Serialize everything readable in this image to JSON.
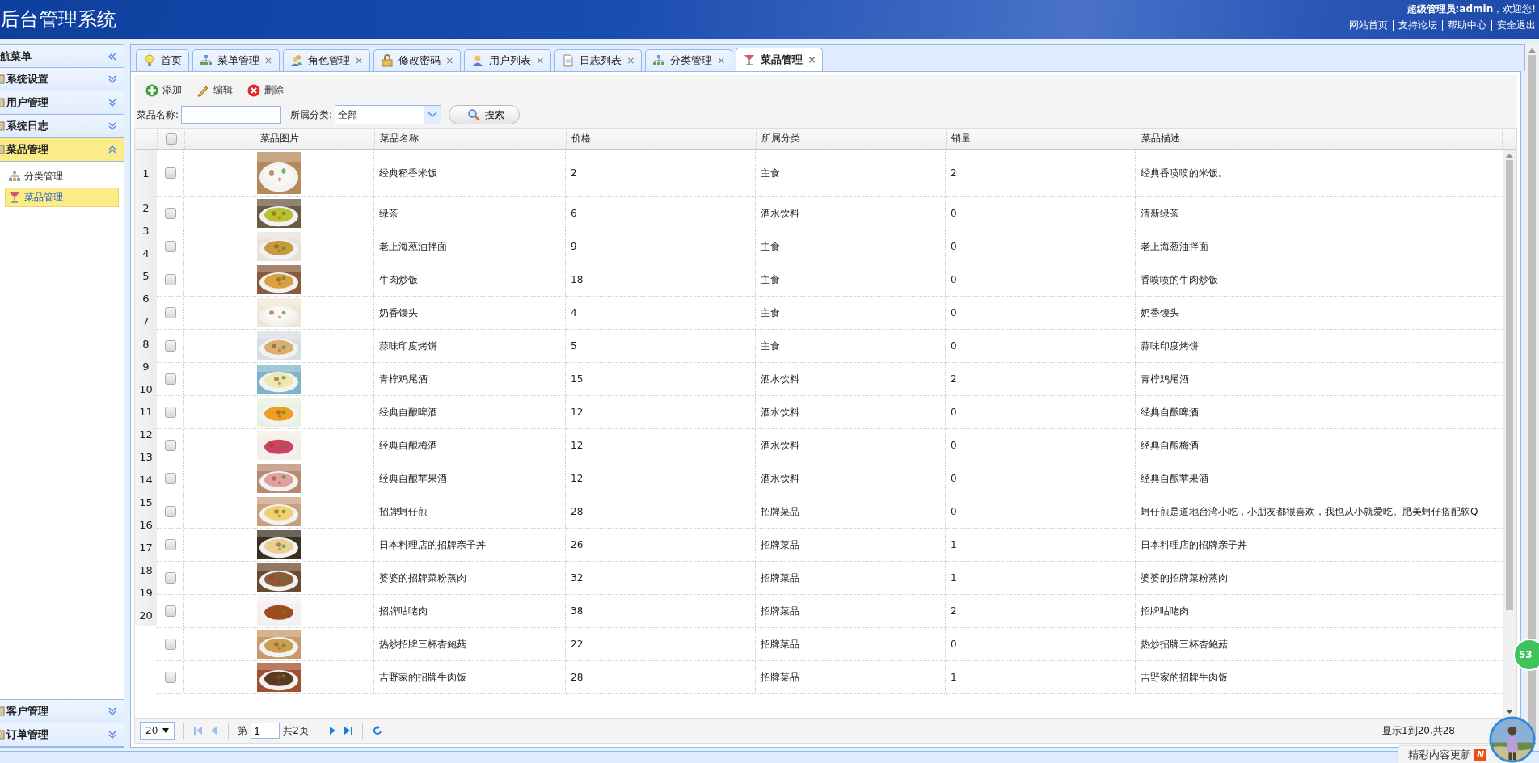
{
  "header": {
    "title": "后台管理系统",
    "welcome": "**超级管理员:admin**，欢迎您!",
    "links": [
      "网站首页",
      "支持论坛",
      "帮助中心",
      "安全退出"
    ]
  },
  "sidebar": {
    "title": "航菜单",
    "groups": [
      {
        "label": "系统设置",
        "expanded": false,
        "selected": false
      },
      {
        "label": "用户管理",
        "expanded": false,
        "selected": false
      },
      {
        "label": "系统日志",
        "expanded": false,
        "selected": false
      },
      {
        "label": "菜品管理",
        "expanded": true,
        "selected": true,
        "children": [
          {
            "label": "分类管理",
            "selected": false
          },
          {
            "label": "菜品管理",
            "selected": true
          }
        ]
      }
    ],
    "bottom_groups": [
      {
        "label": "客户管理",
        "expanded": false,
        "selected": false
      },
      {
        "label": "订单管理",
        "expanded": false,
        "selected": false
      }
    ]
  },
  "tabs": [
    {
      "label": "首页",
      "selected": false
    },
    {
      "label": "菜单管理",
      "close": "×",
      "selected": false
    },
    {
      "label": "角色管理",
      "close": "×",
      "selected": false
    },
    {
      "label": "修改密码",
      "close": "×",
      "selected": false
    },
    {
      "label": "用户列表",
      "close": "×",
      "selected": false
    },
    {
      "label": "日志列表",
      "close": "×",
      "selected": false
    },
    {
      "label": "分类管理",
      "close": "×",
      "selected": false
    },
    {
      "label": "菜品管理",
      "close": "×",
      "selected": true
    }
  ],
  "toolbar": [
    {
      "label": "添加",
      "kind": "add"
    },
    {
      "label": "编辑",
      "kind": "edit"
    },
    {
      "label": "删除",
      "kind": "delete"
    }
  ],
  "search": {
    "name_label": "菜品名称:",
    "category_label": "所属分类:",
    "category_value": "全部",
    "button": "搜索"
  },
  "table": {
    "columns": [
      "菜品图片",
      "菜品名称",
      "价格",
      "所属分类",
      "销量",
      "菜品描述"
    ],
    "all_checked": false,
    "row_numbers": [
      "1",
      "2",
      "3",
      "4",
      "5",
      "6",
      "7",
      "8",
      "9",
      "10",
      "11",
      "12",
      "13",
      "14",
      "15",
      "16",
      "17",
      "18",
      "19",
      "20"
    ],
    "rows": [
      {
        "name": "经典稻香米饭",
        "price": "2",
        "category": "主食",
        "sales": "2",
        "description": "经典香喷喷的米饭。",
        "checked": false
      },
      {
        "name": "绿茶",
        "price": "6",
        "category": "酒水饮料",
        "sales": "0",
        "description": "清新绿茶",
        "checked": false
      },
      {
        "name": "老上海葱油拌面",
        "price": "9",
        "category": "主食",
        "sales": "0",
        "description": "老上海葱油拌面",
        "checked": false
      },
      {
        "name": "牛肉炒饭",
        "price": "18",
        "category": "主食",
        "sales": "0",
        "description": "香喷喷的牛肉炒饭",
        "checked": false
      },
      {
        "name": "奶香馒头",
        "price": "4",
        "category": "主食",
        "sales": "0",
        "description": "奶香馒头",
        "checked": false
      },
      {
        "name": "蒜味印度烤饼",
        "price": "5",
        "category": "主食",
        "sales": "0",
        "description": "蒜味印度烤饼",
        "checked": false
      },
      {
        "name": "青柠鸡尾酒",
        "price": "15",
        "category": "酒水饮料",
        "sales": "2",
        "description": "青柠鸡尾酒",
        "checked": false
      },
      {
        "name": "经典自酿啤酒",
        "price": "12",
        "category": "酒水饮料",
        "sales": "0",
        "description": "经典自酿啤酒",
        "checked": false
      },
      {
        "name": "经典自酿梅酒",
        "price": "12",
        "category": "酒水饮料",
        "sales": "0",
        "description": "经典自酿梅酒",
        "checked": false
      },
      {
        "name": "经典自酿苹果酒",
        "price": "12",
        "category": "酒水饮料",
        "sales": "0",
        "description": "经典自酿苹果酒",
        "checked": false
      },
      {
        "name": "招牌蚵仔煎",
        "price": "28",
        "category": "招牌菜品",
        "sales": "0",
        "description": "蚵仔煎是道地台湾小吃，小朋友都很喜欢，我也从小就爱吃。肥美蚵仔搭配软Q",
        "checked": false
      },
      {
        "name": "日本料理店的招牌亲子丼",
        "price": "26",
        "category": "招牌菜品",
        "sales": "1",
        "description": "日本料理店的招牌亲子丼",
        "checked": false
      },
      {
        "name": "婆婆的招牌菜粉蒸肉",
        "price": "32",
        "category": "招牌菜品",
        "sales": "1",
        "description": "婆婆的招牌菜粉蒸肉",
        "checked": false
      },
      {
        "name": "招牌咕咾肉",
        "price": "38",
        "category": "招牌菜品",
        "sales": "2",
        "description": "招牌咕咾肉",
        "checked": false
      },
      {
        "name": "热炒招牌三杯杏鲍菇",
        "price": "22",
        "category": "招牌菜品",
        "sales": "0",
        "description": "热炒招牌三杯杏鲍菇",
        "checked": false
      },
      {
        "name": "吉野家的招牌牛肉饭",
        "price": "28",
        "category": "招牌菜品",
        "sales": "1",
        "description": "吉野家的招牌牛肉饭",
        "checked": false
      }
    ]
  },
  "pager": {
    "page_size": "20",
    "page_label": "第",
    "page": "1",
    "total_pages": "共2页",
    "summary": "显示1到20,共28"
  },
  "overlay": {
    "badge": "53",
    "news": "精彩内容更新",
    "news_mark": "N"
  }
}
